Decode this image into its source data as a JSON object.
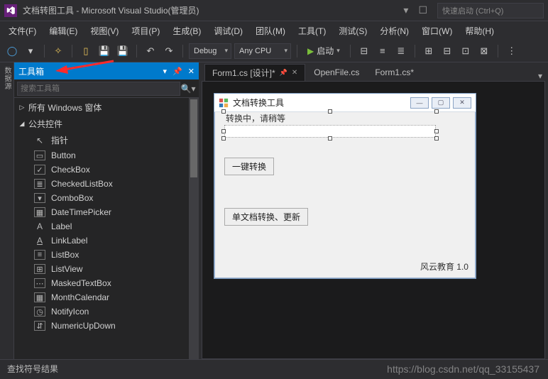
{
  "titlebar": {
    "title": "文档转图工具 - Microsoft Visual Studio(管理员)",
    "quick_launch_placeholder": "快速启动 (Ctrl+Q)"
  },
  "menu": {
    "items": [
      "文件(F)",
      "编辑(E)",
      "视图(V)",
      "项目(P)",
      "生成(B)",
      "调试(D)",
      "团队(M)",
      "工具(T)",
      "测试(S)",
      "分析(N)",
      "窗口(W)",
      "帮助(H)"
    ]
  },
  "toolbar": {
    "config": "Debug",
    "platform": "Any CPU",
    "run_label": "启动"
  },
  "toolbox": {
    "title": "工具箱",
    "search_placeholder": "搜索工具箱",
    "cat1": "所有 Windows 窗体",
    "cat2": "公共控件",
    "items": [
      "指针",
      "Button",
      "CheckBox",
      "CheckedListBox",
      "ComboBox",
      "DateTimePicker",
      "Label",
      "LinkLabel",
      "ListBox",
      "ListView",
      "MaskedTextBox",
      "MonthCalendar",
      "NotifyIcon",
      "NumericUpDown"
    ]
  },
  "vertical_tab": "数据源",
  "tabs": {
    "t0": {
      "label": "Form1.cs [设计]*"
    },
    "t1": {
      "label": "OpenFile.cs"
    },
    "t2": {
      "label": "Form1.cs*"
    }
  },
  "form": {
    "title": "文档转换工具",
    "progress_label": "转换中，请稍等",
    "btn1": "一键转换",
    "btn2": "单文档转换、更新",
    "footer": "风云教育 1.0"
  },
  "bottom": {
    "label": "查找符号结果"
  },
  "watermark": "https://blog.csdn.net/qq_33155437"
}
